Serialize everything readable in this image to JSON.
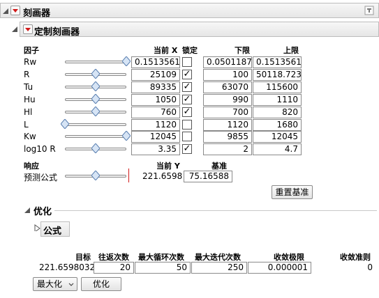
{
  "profiler": {
    "title": "刻画器"
  },
  "custom_profiler": {
    "title": "定制刻画器"
  },
  "factors": {
    "header_factor": "因子",
    "header_current": "当前 X",
    "header_lock": "锁定",
    "header_low": "下限",
    "header_high": "上限",
    "rows": [
      {
        "name": "Rw",
        "value": "0.1513561",
        "locked": false,
        "locked_mark": "",
        "low": "0.0501187",
        "high": "0.1513561",
        "position": 1.0
      },
      {
        "name": "R",
        "value": "25109",
        "locked": true,
        "locked_mark": "✓",
        "low": "100",
        "high": "50118.723",
        "position": 0.5
      },
      {
        "name": "Tu",
        "value": "89335",
        "locked": true,
        "locked_mark": "✓",
        "low": "63070",
        "high": "115600",
        "position": 0.5
      },
      {
        "name": "Hu",
        "value": "1050",
        "locked": true,
        "locked_mark": "✓",
        "low": "990",
        "high": "1110",
        "position": 0.5
      },
      {
        "name": "Hl",
        "value": "760",
        "locked": true,
        "locked_mark": "✓",
        "low": "700",
        "high": "820",
        "position": 0.5
      },
      {
        "name": "L",
        "value": "1120",
        "locked": false,
        "locked_mark": "",
        "low": "1120",
        "high": "1680",
        "position": 0.0
      },
      {
        "name": "Kw",
        "value": "12045",
        "locked": false,
        "locked_mark": "",
        "low": "9855",
        "high": "12045",
        "position": 1.0
      },
      {
        "name": "log10 R",
        "value": "3.35",
        "locked": true,
        "locked_mark": "✓",
        "low": "2",
        "high": "4.7",
        "position": 0.5
      }
    ]
  },
  "response": {
    "header_response": "响应",
    "header_current_y": "当前 Y",
    "header_baseline": "基准",
    "name": "预测公式",
    "current_y": "221.6598",
    "baseline": "75.16588",
    "position": 0.5,
    "reset_button": "重置基准"
  },
  "optimize": {
    "title": "优化",
    "formula_title": "公式",
    "header_target": "目标",
    "header_passes": "往返次数",
    "header_max_loop": "最大循环次数",
    "header_max_iter": "最大迭代次数",
    "header_converge_limit": "收敛极限",
    "header_converge_criteria": "收敛准则",
    "target": "221.6598032",
    "passes": "20",
    "max_loop": "50",
    "max_iter": "250",
    "converge_limit": "0.000001",
    "converge_criteria": "0",
    "mode_select": "最大化",
    "optimize_button": "优化"
  },
  "colors": {
    "accent_red": "#d11a1a",
    "thumb_fill": "#d6e4f5",
    "thumb_stroke": "#5a7fb0"
  }
}
